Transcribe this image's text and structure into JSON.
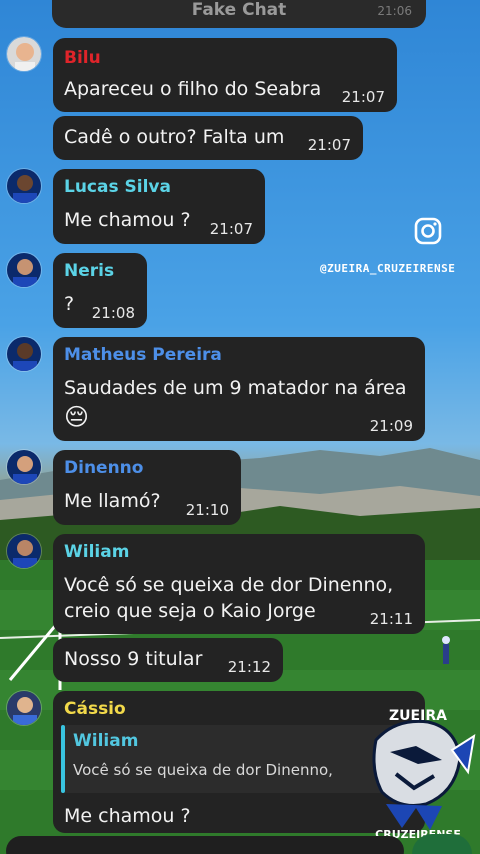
{
  "header": {
    "title": "Fake Chat",
    "time": "21:06"
  },
  "messages": [
    {
      "sender": "Bilu",
      "sender_color": "#e0242a",
      "text": "Apareceu o filho do Seabra",
      "time": "21:07"
    },
    {
      "text": "Cadê o outro? Falta um",
      "time": "21:07"
    },
    {
      "sender": "Lucas Silva",
      "sender_color": "#5bd3e6",
      "text": "Me chamou ?",
      "time": "21:07"
    },
    {
      "sender": "Neris",
      "sender_color": "#5bd3e6",
      "text": "?",
      "time": "21:08"
    },
    {
      "sender": "Matheus Pereira",
      "sender_color": "#4d8fe8",
      "text": "Saudades de um 9 matador na área",
      "emoji": "😔",
      "time": "21:09"
    },
    {
      "sender": "Dinenno",
      "sender_color": "#4d8fe8",
      "text": "Me llamó?",
      "time": "21:10"
    },
    {
      "sender": "Wiliam",
      "sender_color": "#5bd3e6",
      "lines": [
        "Você só se queixa de dor Dinenno,",
        "creio que seja o Kaio Jorge"
      ],
      "time": "21:11"
    },
    {
      "text": "Nosso 9 titular",
      "time": "21:12"
    },
    {
      "sender": "Cássio",
      "sender_color": "#f2d94a",
      "quote": {
        "sender": "Wiliam",
        "text": "Você só se queixa de dor Dinenno,"
      },
      "text": "Me chamou ?"
    }
  ],
  "watermark": {
    "icon": "instagram-icon",
    "handle": "@ZUEIRA_CRUZEIRENSE",
    "logo_text": "ZUEIRA CRUZEIRENSE"
  }
}
